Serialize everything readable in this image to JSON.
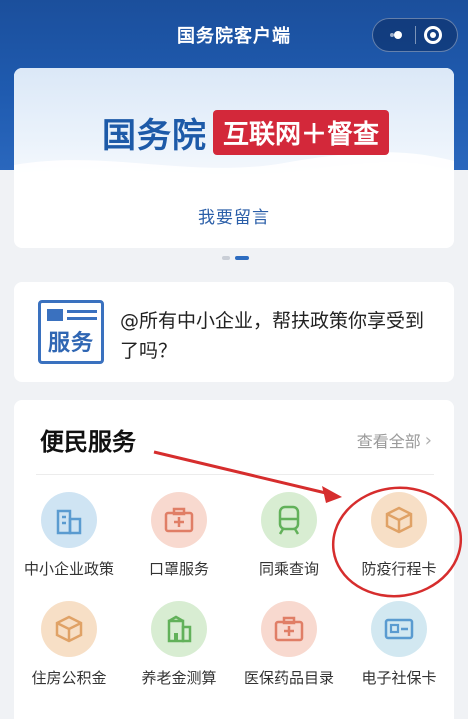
{
  "app": {
    "title": "国务院客户端"
  },
  "banner": {
    "brand_main": "国务院",
    "brand_tag": "互联网＋督查",
    "action_label": "我要留言",
    "pager": {
      "count": 2,
      "active": 2
    }
  },
  "notice": {
    "icon_label": "服务",
    "text": "@所有中小企业，帮扶政策你享受到了吗？"
  },
  "services": {
    "title": "便民服务",
    "view_all": "查看全部",
    "items": [
      {
        "label": "中小企业政策",
        "icon": "building-icon",
        "color": "#cfe4f3"
      },
      {
        "label": "口罩服务",
        "icon": "medical-kit-icon",
        "color": "#f8d9cf"
      },
      {
        "label": "同乘查询",
        "icon": "train-icon",
        "color": "#d8edd2"
      },
      {
        "label": "防疫行程卡",
        "icon": "box-icon",
        "color": "#f7dfc6"
      },
      {
        "label": "住房公积金",
        "icon": "box-icon",
        "color": "#f7dfc6"
      },
      {
        "label": "养老金测算",
        "icon": "house-icon",
        "color": "#d8edd2"
      },
      {
        "label": "医保药品目录",
        "icon": "medical-kit-icon",
        "color": "#f8d9cf"
      },
      {
        "label": "电子社保卡",
        "icon": "id-card-icon",
        "color": "#d2e8f1"
      }
    ]
  },
  "colors": {
    "header": "#1f5bb0",
    "accent_red": "#d3283a",
    "annotation": "#d62d2d"
  }
}
